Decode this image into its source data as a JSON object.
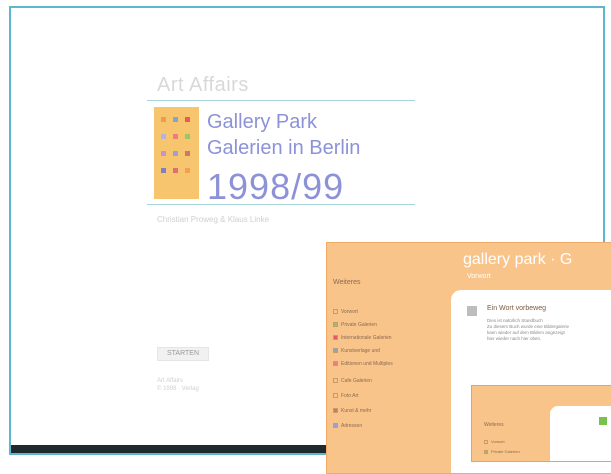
{
  "page": {
    "site_title": "Art Affairs",
    "heading_line1": "Gallery Park",
    "heading_line2": "Galerien in Berlin",
    "year": "1998/99",
    "authors": "Christian Proweg & Klaus Linke"
  },
  "start": {
    "label": "STARTEN"
  },
  "footer": {
    "line1": "Art Affairs",
    "line2": "© 1998 ·  Verlag"
  },
  "swatches": [
    {
      "color": "#f29b4b"
    },
    {
      "color": "#7ea7d8"
    },
    {
      "color": "#e85b5b"
    },
    {
      "color": "#b2b2e8"
    },
    {
      "color": "#f07d7d"
    },
    {
      "color": "#96c86a"
    },
    {
      "color": "#c592d8"
    },
    {
      "color": "#9aa1d6"
    },
    {
      "color": "#c87a6a"
    },
    {
      "color": "#7f7fc8"
    },
    {
      "color": "#e07070"
    },
    {
      "color": "#f0a050"
    }
  ],
  "preview": {
    "title": "gallery park · G",
    "subtitle": "Vorwort",
    "nav_heading": "Weiteres",
    "nav_items": [
      {
        "label": "Vorwort",
        "color": "#f9c48a"
      },
      {
        "label": "Private Galerien",
        "color": "#86c86a"
      },
      {
        "label": "Internationale Galerien",
        "color": "#e85b5b"
      },
      {
        "label": "Kunstverlage und",
        "color": "#7ea7d8"
      },
      {
        "label": "Editionen und Multiples",
        "color": "#f07d7d"
      },
      {
        "label": "Cafe Galerien",
        "color": "#f9c48a"
      },
      {
        "label": "Foto Art",
        "color": "#f9c48a"
      },
      {
        "label": "Kunst & mehr",
        "color": "#c87a6a"
      },
      {
        "label": "Adressen",
        "color": "#9aa1d6"
      }
    ],
    "content_heading": "Ein Wort vorbeweg",
    "content_lines": [
      "Dies ist natürlich Standbuch",
      "Zu diesem Buch wurde eine Bildergalerie",
      "kann wieder auf dem Bildern angezeigt",
      "hier wieder nach hier oben."
    ]
  },
  "preview2": {
    "nav_heading": "Weiteres",
    "nav_items": [
      {
        "label": "Vorwort",
        "color": "#f9c48a"
      },
      {
        "label": "Private Galerien",
        "color": "#86c86a"
      }
    ]
  }
}
